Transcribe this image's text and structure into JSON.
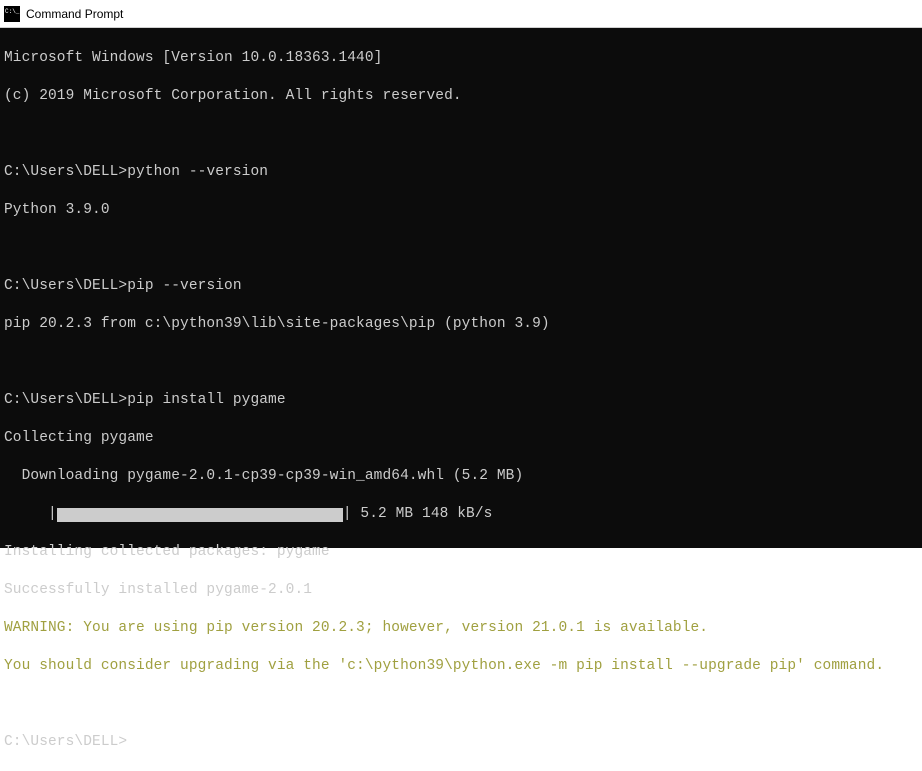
{
  "window": {
    "title": "Command Prompt"
  },
  "terminal": {
    "header1": "Microsoft Windows [Version 10.0.18363.1440]",
    "header2": "(c) 2019 Microsoft Corporation. All rights reserved.",
    "prompt_path": "C:\\Users\\DELL>",
    "cmd1": "python --version",
    "out1": "Python 3.9.0",
    "cmd2": "pip --version",
    "out2": "pip 20.2.3 from c:\\python39\\lib\\site-packages\\pip (python 3.9)",
    "cmd3": "pip install pygame",
    "collect": "Collecting pygame",
    "download": "  Downloading pygame-2.0.1-cp39-cp39-win_amd64.whl (5.2 MB)",
    "progress_indent": "     |",
    "progress_suffix": "| 5.2 MB 148 kB/s",
    "install": "Installing collected packages: pygame",
    "success": "Successfully installed pygame-2.0.1",
    "warn1": "WARNING: You are using pip version 20.2.3; however, version 21.0.1 is available.",
    "warn2": "You should consider upgrading via the 'c:\\python39\\python.exe -m pip install --upgrade pip' command."
  }
}
